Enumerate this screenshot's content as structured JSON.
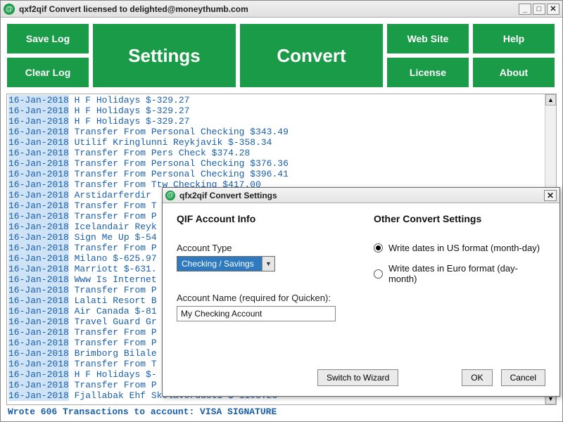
{
  "titlebar": {
    "title": "qxf2qif Convert licensed to delighted@moneythumb.com"
  },
  "toolbar": {
    "save_log": "Save Log",
    "clear_log": "Clear Log",
    "settings": "Settings",
    "convert": "Convert",
    "web_site": "Web Site",
    "license": "License",
    "help": "Help",
    "about": "About"
  },
  "log_lines": [
    "16-Jan-2018 H F Holidays $-329.27",
    "16-Jan-2018 H F Holidays $-329.27",
    "16-Jan-2018 H F Holidays $-329.27",
    "16-Jan-2018 Transfer From Personal Checking $343.49",
    "16-Jan-2018 Utilif Kringlunni Reykjavik $-358.34",
    "16-Jan-2018 Transfer From Pers Check $374.28",
    "16-Jan-2018 Transfer From Personal Checking $376.36",
    "16-Jan-2018 Transfer From Personal Checking $396.41",
    "16-Jan-2018 Transfer From Ttw Checking $417.00",
    "16-Jan-2018 Arstidarferdir",
    "16-Jan-2018 Transfer From T",
    "16-Jan-2018 Transfer From P",
    "16-Jan-2018 Icelandair Reyk",
    "16-Jan-2018 Sign Me Up $-54",
    "16-Jan-2018 Transfer From P",
    "16-Jan-2018 Milano $-625.97",
    "16-Jan-2018 Marriott $-631.",
    "16-Jan-2018 Www Is Internet",
    "16-Jan-2018 Transfer From P",
    "16-Jan-2018 Lalati Resort B",
    "16-Jan-2018 Air Canada $-81",
    "16-Jan-2018 Travel Guard Gr",
    "16-Jan-2018 Transfer From P",
    "16-Jan-2018 Transfer From P",
    "16-Jan-2018 Brimborg Bilale",
    "16-Jan-2018 Transfer From T",
    "16-Jan-2018 H F Holidays $-",
    "16-Jan-2018 Transfer From P",
    "16-Jan-2018 Fjallabak Ehf Skolavordusti $-1103.23"
  ],
  "status": "Wrote 606 Transactions to account: VISA SIGNATURE",
  "modal": {
    "title": "qfx2qif Convert Settings",
    "left_heading": "QIF Account Info",
    "right_heading": "Other Convert Settings",
    "account_type_label": "Account Type",
    "account_type_value": "Checking / Savings",
    "account_name_label": "Account Name (required for Quicken):",
    "account_name_value": "My Checking Account",
    "radio_us": "Write dates in US format (month-day)",
    "radio_euro": "Write dates in Euro format (day-month)",
    "switch_btn": "Switch to Wizard",
    "ok_btn": "OK",
    "cancel_btn": "Cancel"
  }
}
